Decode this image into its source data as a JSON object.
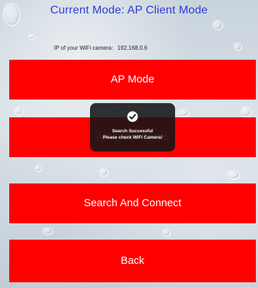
{
  "header": {
    "mode_label": "Current Mode: AP Client Mode"
  },
  "camera_info": {
    "ip_label": "IP of your WiFi camera:",
    "ip_value": "192.168.0.6"
  },
  "buttons": {
    "ap_mode": "AP Mode",
    "client_mode": "AP Client Mode",
    "search_connect": "Search And Connect",
    "back": "Back"
  },
  "toast": {
    "icon": "checkmark-icon",
    "title": "Search Successful",
    "message": "Please check WiFi Camera!"
  },
  "colors": {
    "button_bg": "#ff0000",
    "title_text": "#2b3bd6"
  }
}
